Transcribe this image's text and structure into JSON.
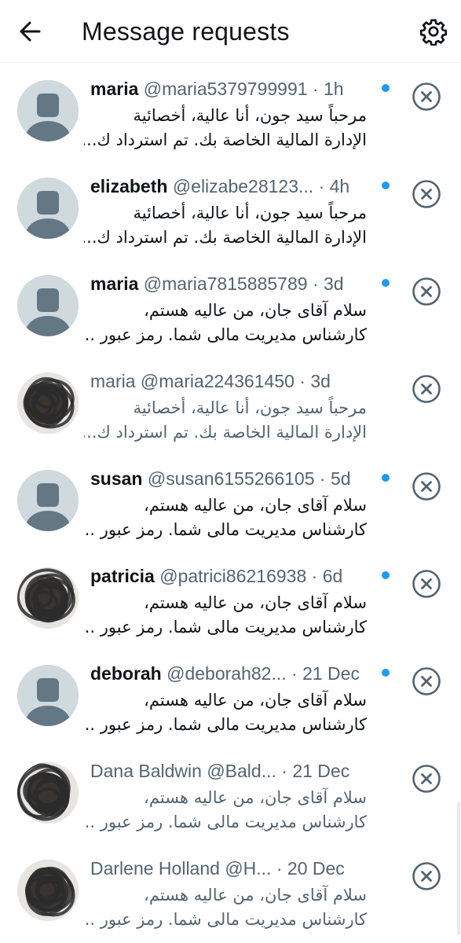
{
  "header": {
    "title": "Message requests",
    "back_icon": "arrow-left-icon",
    "settings_icon": "gear-icon"
  },
  "colors": {
    "accent": "#1d9bf0",
    "text": "#0f1419",
    "secondary": "#536471"
  },
  "requests": [
    {
      "name": "maria",
      "handle": "@maria5379799991",
      "time": "· 1h",
      "line1": "مرحباً سيد جون، أنا عالية، أخصائية",
      "line2": "الإدارة المالية الخاصة بك. تم استرداد ك...",
      "unread": true,
      "avatar": "default-avatar"
    },
    {
      "name": "elizabeth",
      "handle": "@elizabe28123...",
      "time": "· 4h",
      "line1": "مرحباً سيد جون، أنا عالية، أخصائية",
      "line2": "الإدارة المالية الخاصة بك. تم استرداد ك...",
      "unread": true,
      "avatar": "default-avatar"
    },
    {
      "name": "maria",
      "handle": "@maria7815885789",
      "time": "· 3d",
      "line1": "سلام آقای جان، من عالیه هستم،",
      "line2": "کارشناس مدیریت مالی شما. رمز عبور ...",
      "unread": true,
      "avatar": "default-avatar"
    },
    {
      "name": "maria",
      "handle": "@maria224361450",
      "time": "· 3d",
      "line1": "مرحباً سيد جون، أنا عالية، أخصائية",
      "line2": "الإدارة المالية الخاصة بك. تم استرداد ك...",
      "unread": false,
      "avatar": "scribbled-avatar"
    },
    {
      "name": "susan",
      "handle": "@susan6155266105",
      "time": "· 5d",
      "line1": "سلام آقای جان، من عالیه هستم،",
      "line2": "کارشناس مدیریت مالی شما. رمز عبور ...",
      "unread": true,
      "avatar": "default-avatar"
    },
    {
      "name": "patricia",
      "handle": "@patrici86216938",
      "time": "· 6d",
      "line1": "سلام آقای جان، من عالیه هستم،",
      "line2": "کارشناس مدیریت مالی شما. رمز عبور ...",
      "unread": true,
      "avatar": "scribbled-avatar"
    },
    {
      "name": "deborah",
      "handle": "@deborah82...",
      "time": "· 21 Dec",
      "line1": "سلام آقای جان، من عالیه هستم،",
      "line2": "کارشناس مدیریت مالی شما. رمز عبور ...",
      "unread": true,
      "avatar": "default-avatar"
    },
    {
      "name": "Dana Baldwin",
      "handle": "@Bald...",
      "time": "· 21 Dec",
      "line1": "سلام آقای جان، من عالیه هستم،",
      "line2": "کارشناس مدیریت مالی شما. رمز عبور ...",
      "unread": false,
      "avatar": "scribbled-avatar"
    },
    {
      "name": "Darlene Holland",
      "handle": "@H...",
      "time": "· 20 Dec",
      "line1": "سلام آقای جان، من عالیه هستم،",
      "line2": "کارشناس مدیریت مالی شما. رمز عبور ...",
      "unread": false,
      "avatar": "scribbled-avatar"
    }
  ]
}
